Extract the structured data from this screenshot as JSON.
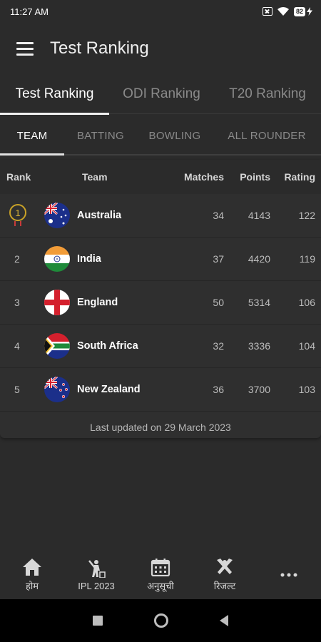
{
  "status_bar": {
    "time": "11:27 AM",
    "battery": "82"
  },
  "app_bar": {
    "title": "Test Ranking"
  },
  "primary_tabs": [
    {
      "label": "Test Ranking",
      "active": true
    },
    {
      "label": "ODI Ranking",
      "active": false
    },
    {
      "label": "T20 Ranking",
      "active": false
    }
  ],
  "sub_tabs": [
    {
      "label": "TEAM",
      "active": true
    },
    {
      "label": "BATTING",
      "active": false
    },
    {
      "label": "BOWLING",
      "active": false
    },
    {
      "label": "ALL ROUNDER",
      "active": false
    }
  ],
  "table": {
    "headers": {
      "rank": "Rank",
      "team": "Team",
      "matches": "Matches",
      "points": "Points",
      "rating": "Rating"
    },
    "rows": [
      {
        "rank": "1",
        "team": "Australia",
        "matches": "34",
        "points": "4143",
        "rating": "122",
        "flag": "australia-flag-icon"
      },
      {
        "rank": "2",
        "team": "India",
        "matches": "37",
        "points": "4420",
        "rating": "119",
        "flag": "india-flag-icon"
      },
      {
        "rank": "3",
        "team": "England",
        "matches": "50",
        "points": "5314",
        "rating": "106",
        "flag": "england-flag-icon"
      },
      {
        "rank": "4",
        "team": "South Africa",
        "matches": "32",
        "points": "3336",
        "rating": "104",
        "flag": "south-africa-flag-icon"
      },
      {
        "rank": "5",
        "team": "New Zealand",
        "matches": "36",
        "points": "3700",
        "rating": "103",
        "flag": "new-zealand-flag-icon"
      }
    ],
    "last_updated": "Last updated on 29 March 2023"
  },
  "bottom_nav": [
    {
      "label": "होम",
      "icon": "home-icon"
    },
    {
      "label": "IPL 2023",
      "icon": "cricket-player-icon"
    },
    {
      "label": "अनुसूची",
      "icon": "calendar-icon"
    },
    {
      "label": "रिजल्ट",
      "icon": "cricket-bats-icon"
    },
    {
      "label": "",
      "icon": "more-icon"
    }
  ],
  "colors": {
    "background": "#2b2b2b",
    "card": "#2f2f2f",
    "medal_gold": "#c9a227",
    "system_nav": "#000000"
  }
}
